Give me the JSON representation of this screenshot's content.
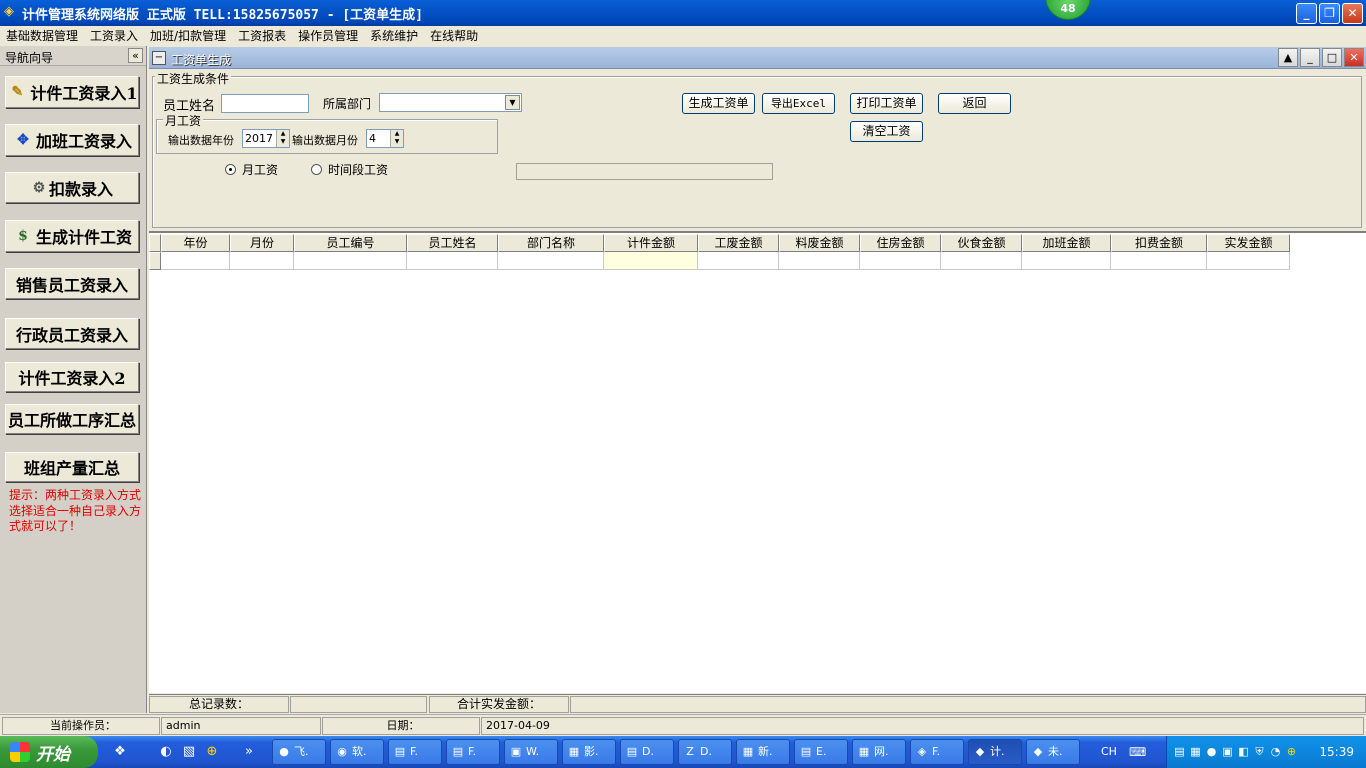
{
  "window": {
    "title": "计件管理系统网络版 正式版 TELL:15825675057 - [工资单生成]",
    "badge": "48"
  },
  "menu": [
    "基础数据管理",
    "工资录入",
    "加班/扣款管理",
    "工资报表",
    "操作员管理",
    "系统维护",
    "在线帮助"
  ],
  "sidebar": {
    "title": "导航向导",
    "collapse_glyph": "«",
    "items": [
      {
        "label": "计件工资录入1",
        "icon": "form-icon"
      },
      {
        "label": "加班工资录入",
        "icon": "arrows-icon"
      },
      {
        "label": "扣款录入",
        "icon": "deduct-icon"
      },
      {
        "label": "生成计件工资",
        "icon": "money-bag-icon"
      },
      {
        "label": "销售员工资录入",
        "icon": ""
      },
      {
        "label": "行政员工资录入",
        "icon": ""
      },
      {
        "label": "计件工资录入2",
        "icon": ""
      },
      {
        "label": "员工所做工序汇总",
        "icon": ""
      },
      {
        "label": "班组产量汇总",
        "icon": ""
      }
    ],
    "hint": "提示：两种工资录入方式选择适合一种自己录入方式就可以了！"
  },
  "child": {
    "title": "工资单生成",
    "conditions": {
      "group_label": "工资生成条件",
      "employee_name_label": "员工姓名",
      "employee_name_value": "",
      "department_label": "所属部门",
      "department_value": "",
      "monthly_group_label": "月工资",
      "year_label": "输出数据年份",
      "year_value": "2017",
      "month_label": "输出数据月份",
      "month_value": "4",
      "radio_monthly": "月工资",
      "radio_period": "时间段工资"
    },
    "buttons": {
      "generate": "生成工资单",
      "export": "导出Excel",
      "print": "打印工资单",
      "back": "返回",
      "clear": "清空工资"
    },
    "grid": {
      "columns": [
        "年份",
        "月份",
        "员工编号",
        "员工姓名",
        "部门名称",
        "计件金额",
        "工废金额",
        "料废金额",
        "住房金额",
        "伙食金额",
        "加班金额",
        "扣费金额",
        "实发金额"
      ]
    },
    "footer": {
      "total_records_label": "总记录数：",
      "total_records_value": "",
      "total_pay_label": "合计实发金额：",
      "total_pay_value": ""
    }
  },
  "statusbar": {
    "operator_label": "当前操作员：",
    "operator_value": "admin",
    "date_label": "日期：",
    "date_value": "2017-04-09"
  },
  "taskbar": {
    "start_label": "开始",
    "tasks": [
      {
        "label": "飞.",
        "icon": "●"
      },
      {
        "label": "软.",
        "icon": "◉"
      },
      {
        "label": "F.",
        "icon": "▤"
      },
      {
        "label": "F.",
        "icon": "▤"
      },
      {
        "label": "W.",
        "icon": "▣"
      },
      {
        "label": "影.",
        "icon": "▦"
      },
      {
        "label": "D.",
        "icon": "▤"
      },
      {
        "label": "D.",
        "icon": "Z"
      },
      {
        "label": "新.",
        "icon": "▦"
      },
      {
        "label": "E.",
        "icon": "▤"
      },
      {
        "label": "网.",
        "icon": "▦"
      },
      {
        "label": "F.",
        "icon": "◈"
      },
      {
        "label": "计.",
        "icon": "◆"
      },
      {
        "label": "未.",
        "icon": "◆"
      }
    ],
    "lang": "CH",
    "clock": "15:39"
  },
  "colors": {
    "titlebar": "#0453c4",
    "hint_text": "#e00000",
    "selected_cell": "#ffffe0"
  }
}
